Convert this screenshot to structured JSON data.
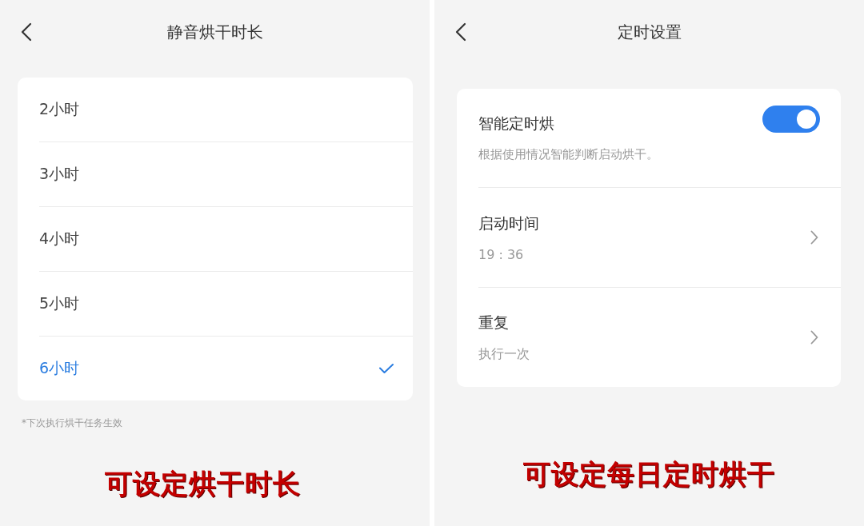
{
  "panels": [
    {
      "kind": "options",
      "header": {
        "title": "静音烘干时长"
      },
      "options": [
        {
          "label": "2小时",
          "selected": false
        },
        {
          "label": "3小时",
          "selected": false
        },
        {
          "label": "4小时",
          "selected": false
        },
        {
          "label": "5小时",
          "selected": false
        },
        {
          "label": "6小时",
          "selected": true
        }
      ],
      "footnote": "*下次执行烘干任务生效",
      "caption": "可设定烘干时长"
    },
    {
      "kind": "settings",
      "header": {
        "title": "定时设置"
      },
      "settings": [
        {
          "kind": "toggle",
          "label": "智能定时烘",
          "description": "根据使用情况智能判断启动烘干。",
          "on": true
        },
        {
          "kind": "link",
          "label": "启动时间",
          "value": "19 : 36"
        },
        {
          "kind": "link",
          "label": "重复",
          "value": "执行一次"
        }
      ],
      "caption": "可设定每日定时烘干"
    }
  ]
}
